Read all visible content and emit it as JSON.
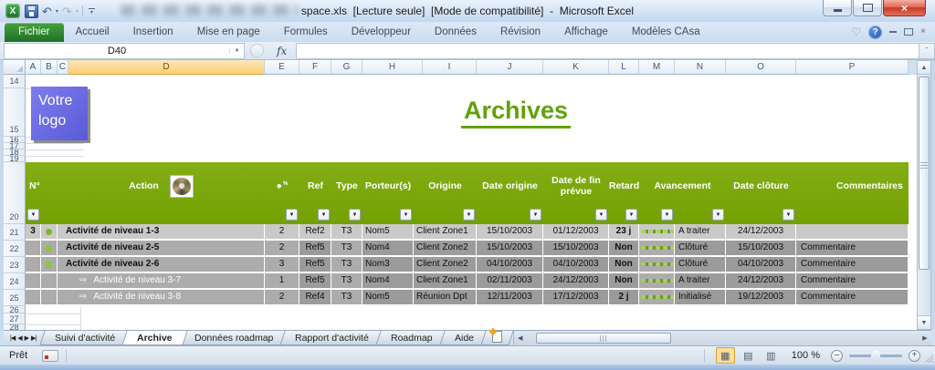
{
  "window": {
    "title": "space.xls  [Lecture seule]  [Mode de compatibilité]  -  Microsoft Excel"
  },
  "ribbon": {
    "tabs": [
      {
        "label": "Fichier",
        "active": true
      },
      {
        "label": "Accueil",
        "active": false
      },
      {
        "label": "Insertion",
        "active": false
      },
      {
        "label": "Mise en page",
        "active": false
      },
      {
        "label": "Formules",
        "active": false
      },
      {
        "label": "Développeur",
        "active": false
      },
      {
        "label": "Données",
        "active": false
      },
      {
        "label": "Révision",
        "active": false
      },
      {
        "label": "Affichage",
        "active": false
      },
      {
        "label": "Modèles CAsa",
        "active": false
      }
    ]
  },
  "formula_bar": {
    "name_box": "D40",
    "fx_label": "fx",
    "formula_value": ""
  },
  "grid": {
    "columns": [
      "A",
      "B",
      "C",
      "D",
      "E",
      "F",
      "G",
      "H",
      "I",
      "J",
      "K",
      "L",
      "M",
      "N",
      "O",
      "P"
    ],
    "selected_column": "D",
    "row_labels": [
      "14",
      "15",
      "16",
      "17",
      "18",
      "19",
      "20",
      "21",
      "22",
      "23",
      "24",
      "25",
      "26",
      "27",
      "28"
    ]
  },
  "sheet": {
    "logo": "Votre\nlogo",
    "title": "Archives"
  },
  "table": {
    "headers": {
      "no": "N°",
      "action": "Action",
      "count": "●",
      "count_sup": "%",
      "ref": "Ref",
      "type": "Type",
      "porteur": "Porteur(s)",
      "origine": "Origine",
      "date_origine": "Date origine",
      "date_fin": "Date de fin prévue",
      "retard": "Retard",
      "avancement": "Avancement",
      "date_cloture": "Date clôture",
      "commentaires": "Commentaires"
    },
    "rows": [
      {
        "no": "3",
        "bullet": "circle",
        "action": "Activité de niveau 1-3",
        "count": "2",
        "ref": "Ref2",
        "type": "T3",
        "porteur": "Nom5",
        "origine": "Client Zone1",
        "date_origine": "15/10/2003",
        "date_fin": "01/12/2003",
        "retard": "23 j",
        "dots": 9,
        "statut": "A traiter",
        "date_cloture": "24/12/2003",
        "commentaire": "",
        "shade": "light",
        "sub": false
      },
      {
        "no": "",
        "bullet": "square",
        "action": "Activité de niveau 2-5",
        "count": "2",
        "ref": "Ref5",
        "type": "T3",
        "porteur": "Nom4",
        "origine": "Client Zone2",
        "date_origine": "15/10/2003",
        "date_fin": "15/10/2003",
        "retard": "Non",
        "dots": 9,
        "statut": "Clôturé",
        "date_cloture": "15/10/2003",
        "commentaire": "Commentaire",
        "shade": "dark",
        "sub": false
      },
      {
        "no": "",
        "bullet": "square",
        "action": "Activité de niveau 2-6",
        "count": "3",
        "ref": "Ref5",
        "type": "T3",
        "porteur": "Nom3",
        "origine": "Client Zone2",
        "date_origine": "04/10/2003",
        "date_fin": "04/10/2003",
        "retard": "Non",
        "dots": 9,
        "statut": "Clôturé",
        "date_cloture": "04/10/2003",
        "commentaire": "Commentaire",
        "shade": "dark",
        "sub": false
      },
      {
        "no": "",
        "bullet": "arrow",
        "action": "Activité de niveau 3-7",
        "count": "1",
        "ref": "Ref5",
        "type": "T3",
        "porteur": "Nom4",
        "origine": "Client Zone1",
        "date_origine": "02/11/2003",
        "date_fin": "24/12/2003",
        "retard": "Non",
        "dots": 9,
        "statut": "A traiter",
        "date_cloture": "24/12/2003",
        "commentaire": "Commentaire",
        "shade": "dark",
        "sub": true
      },
      {
        "no": "",
        "bullet": "arrow",
        "action": "Activité de niveau 3-8",
        "count": "2",
        "ref": "Ref4",
        "type": "T3",
        "porteur": "Nom5",
        "origine": "Réunion Dpt",
        "date_origine": "12/11/2003",
        "date_fin": "17/12/2003",
        "retard": "2 j",
        "dots": 9,
        "statut": "Initialisé",
        "date_cloture": "19/12/2003",
        "commentaire": "Commentaire",
        "shade": "dark",
        "sub": true
      }
    ]
  },
  "sheets": [
    {
      "label": "Suivi d'activité",
      "active": false
    },
    {
      "label": "Archive",
      "active": true
    },
    {
      "label": "Données roadmap",
      "active": false
    },
    {
      "label": "Rapport d'activité",
      "active": false
    },
    {
      "label": "Roadmap",
      "active": false
    },
    {
      "label": "Aide",
      "active": false
    }
  ],
  "status_bar": {
    "ready": "Prêt",
    "zoom": "100 %"
  },
  "icons": {
    "excel_logo": "X",
    "undo": "↶",
    "redo": "↷",
    "dropdown": "▾",
    "heart": "♡",
    "help": "?",
    "close": "×",
    "name_box_arrow": "▼",
    "formula_expand": "ˇ",
    "scroll_up": "▲",
    "scroll_down": "▼",
    "scroll_left": "◀",
    "scroll_right": "▶",
    "tab_first": "|◀",
    "tab_prev": "◀",
    "tab_next": "▶",
    "tab_last": "▶|",
    "filter_arrow": "▼",
    "subtask_arrow": "⇨",
    "view_normal": "▦",
    "view_layout": "▤",
    "view_break": "▥",
    "zoom_out": "–",
    "zoom_in": "+"
  }
}
